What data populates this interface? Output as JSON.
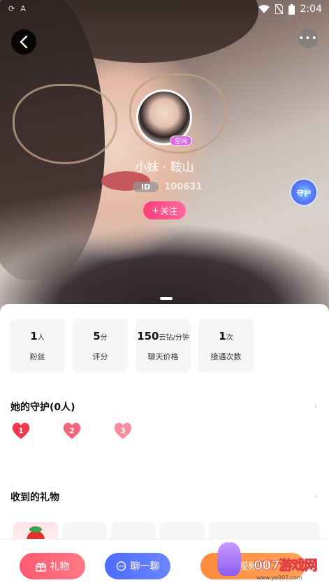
{
  "status_bar": {
    "time": "2:04",
    "left_icons": [
      "sync-icon",
      "a-icon"
    ],
    "right_icons": [
      "wifi-icon",
      "no-sim-icon",
      "battery-icon"
    ]
  },
  "header": {
    "back_icon": "chevron-left-icon",
    "more_icon": "more-dots-icon"
  },
  "profile": {
    "status_badge": "空闲",
    "name": "小妹 · 鞍山",
    "id_label": "ID",
    "id_value": "100631",
    "follow_label": "关注",
    "guard_badge": "守护"
  },
  "stats": [
    {
      "value": "1",
      "unit": "人",
      "label": "粉丝"
    },
    {
      "value": "5",
      "unit": "分",
      "label": "评分"
    },
    {
      "value": "150",
      "unit": "云钻/分钟",
      "label": "聊天价格"
    },
    {
      "value": "1",
      "unit": "次",
      "label": "接通次数"
    }
  ],
  "guard_section": {
    "title": "她的守护(0人)",
    "hearts": [
      "1",
      "2",
      "3"
    ],
    "heart_colors": [
      "#f2384e",
      "#f5677a",
      "#f58fa0"
    ]
  },
  "gifts_section": {
    "title": "收到的礼物"
  },
  "bottom_bar": {
    "gift_label": "礼物",
    "chat_label": "聊一聊",
    "video_label": "视频聊"
  },
  "watermark": {
    "text": "007游戏网",
    "url": "www.yx007.com"
  },
  "colors": {
    "follow": "#ff3d7a",
    "gift_button": "#ff5a6e",
    "chat_button": "#4d6bff",
    "video_button": "#ff8a3d",
    "idle_badge": "#d96be0"
  }
}
